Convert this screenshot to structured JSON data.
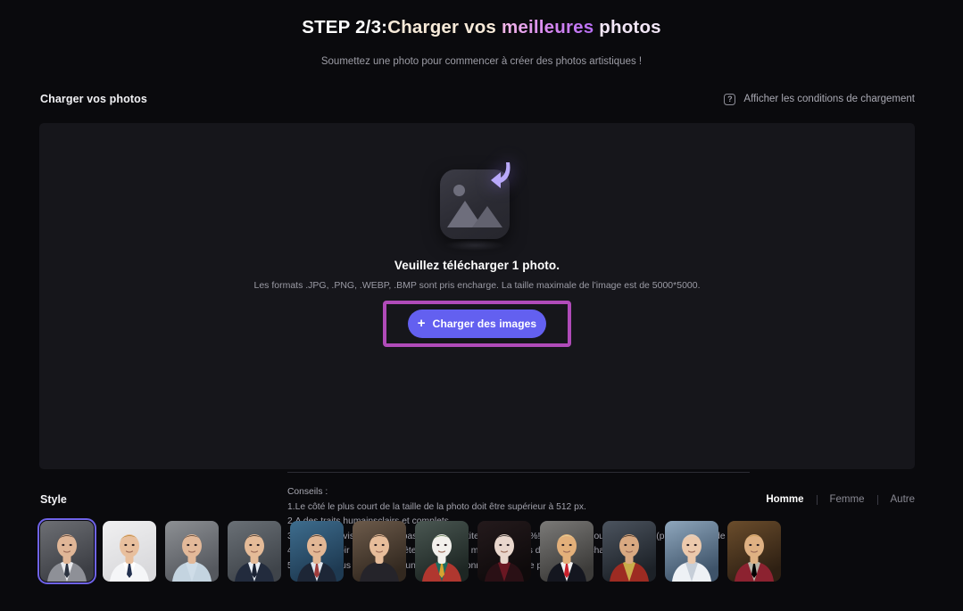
{
  "header": {
    "title_step": "STEP 2/3:",
    "title_part_a": "Charger vos ",
    "title_part_b": "meilleures",
    "title_part_c": " photos",
    "subtitle": "Soumettez une photo pour commencer à créer des photos artistiques !"
  },
  "upload_section": {
    "section_title": "Charger vos photos",
    "conditions_label": "Afficher les conditions de chargement",
    "conditions_icon": "question-mark-icon",
    "illustration_icon": "image-upload-icon",
    "headline": "Veuillez télécharger 1 photo.",
    "formats_note": "Les formats .JPG, .PNG, .WEBP, .BMP sont pris encharge. La taille maximale de l'image est de 5000*5000.",
    "button_label": "Charger des images",
    "button_plus": "+",
    "button_color": "#6360f0",
    "highlight_color": "#b04bb9",
    "tips_title": "Conseils :",
    "tips": [
      "1.Le côté le plus court de la taille de la photo doit être supérieur à 512 px.",
      "2.A des traits humainsclairs et complets.",
      "3.La zone du visage ne doit pas être trop petite (moins de 4%! de la photo) ou trop grande (plus de 50%! de la photo).",
      "4.Évitez d'avoir les mêmes vêtements ou les mêmes scènes dans vos téléchargements.",
      "5.Assurez-vous qu'il n'y a qu'une seule personne sur chaque photo."
    ]
  },
  "style_section": {
    "title": "Style",
    "gender_tabs": [
      {
        "label": "Homme",
        "active": true
      },
      {
        "label": "Femme",
        "active": false
      },
      {
        "label": "Autre",
        "active": false
      }
    ],
    "selected_index": 0,
    "selected_border_color": "#6f63e8",
    "thumbnails": [
      {
        "name": "style-young-man-grey-suit",
        "selected": true,
        "bg": "#6d6f74",
        "bg2": "#3c3e44",
        "skin": "#e0b697",
        "hair": "#3a2a22",
        "cloth": "#8e9097",
        "shirt": "#e9eaee",
        "tie": "#2b3240"
      },
      {
        "name": "style-businessman-white-shirt",
        "selected": false,
        "bg": "#f0f0f1",
        "bg2": "#d9d9dc",
        "skin": "#e8bf9d",
        "hair": "#b5832f",
        "cloth": "#f5f6f8",
        "shirt": "#ffffff",
        "tie": "#22304f"
      },
      {
        "name": "style-man-light-blue-shirt",
        "selected": false,
        "bg": "#8d9094",
        "bg2": "#55585e",
        "skin": "#e3b999",
        "hair": "#4a3424",
        "cloth": "#c4d4e0",
        "shirt": "#cfdde8",
        "tie": ""
      },
      {
        "name": "style-man-navy-suit",
        "selected": false,
        "bg": "#6a7076",
        "bg2": "#3f444a",
        "skin": "#e5bb98",
        "hair": "#2d2018",
        "cloth": "#222b3d",
        "shirt": "#e9eef5",
        "tie": "#1a2233"
      },
      {
        "name": "style-student-blue-backdrop",
        "selected": false,
        "bg": "#3e6d8e",
        "bg2": "#1e3a52",
        "skin": "#e2b795",
        "hair": "#2b1d15",
        "cloth": "#1d2636",
        "shirt": "#dfe6ee",
        "tie": "#9e3b3b"
      },
      {
        "name": "style-man-black-tank-top",
        "selected": false,
        "bg": "#6d5b4b",
        "bg2": "#32281f",
        "skin": "#e7bd9a",
        "hair": "#33251b",
        "cloth": "#25242a",
        "shirt": "",
        "tie": ""
      },
      {
        "name": "style-joker-clown",
        "selected": false,
        "bg": "#4a5752",
        "bg2": "#1d2623",
        "skin": "#f2f0ec",
        "hair": "#51703e",
        "cloth": "#b0372f",
        "shirt": "#1f6b5d",
        "tie": "#d6a431"
      },
      {
        "name": "style-vampire-dark",
        "selected": false,
        "bg": "#241a1c",
        "bg2": "#0e0a0b",
        "skin": "#e9d7cd",
        "hair": "#17120f",
        "cloth": "#2a1015",
        "shirt": "#6a1722",
        "tie": ""
      },
      {
        "name": "style-politician-red-tie",
        "selected": false,
        "bg": "#7b7a78",
        "bg2": "#3c3b39",
        "skin": "#e3b07a",
        "hair": "#e8d79a",
        "cloth": "#14161f",
        "shirt": "#f2f2f2",
        "tie": "#c9202b"
      },
      {
        "name": "style-iron-man-armor",
        "selected": false,
        "bg": "#4c545f",
        "bg2": "#1c2127",
        "skin": "#d9a981",
        "hair": "#241913",
        "cloth": "#9d2b22",
        "shirt": "#c9ac4a",
        "tie": ""
      },
      {
        "name": "style-astronaut-white-suit",
        "selected": false,
        "bg": "#8fa7bd",
        "bg2": "#3e5369",
        "skin": "#ecc9ac",
        "hair": "#d8d6d2",
        "cloth": "#eef1f5",
        "shirt": "#c6ced8",
        "tie": ""
      },
      {
        "name": "style-medieval-king",
        "selected": false,
        "bg": "#6b4d2c",
        "bg2": "#2e2013",
        "skin": "#dfb183",
        "hair": "#c99a4e",
        "cloth": "#8c2230",
        "shirt": "#b9b5a8",
        "tie": "#d8b martin"
      }
    ]
  }
}
